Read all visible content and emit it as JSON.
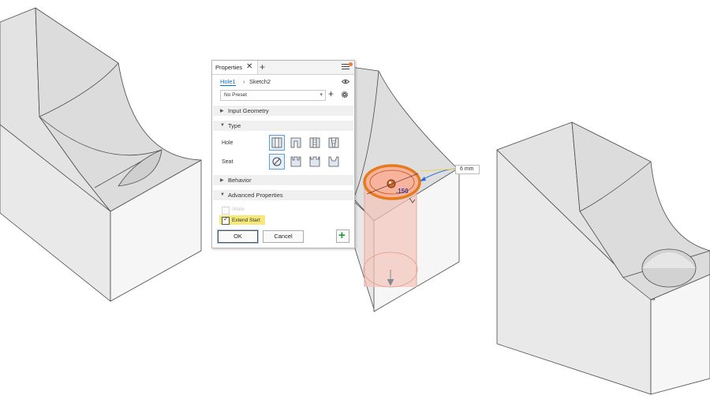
{
  "panel": {
    "tab_label": "Properties",
    "tab_close": "✕",
    "tab_add": "+",
    "breadcrumb": {
      "feature": "Hole1",
      "separator": "›",
      "sketch": "Sketch2"
    },
    "preset": {
      "value": "No Preset",
      "arrow": "▾"
    },
    "preset_add": "+",
    "sections": {
      "input_geometry": "Input Geometry",
      "type": "Type",
      "behavior": "Behavior",
      "advanced": "Advanced Properties"
    },
    "arrows": {
      "collapsed": "▶",
      "expanded": "▼"
    },
    "type_rows": {
      "hole": "Hole",
      "seat": "Seat"
    },
    "disabled_option": "iMate",
    "extend_start": {
      "label": "Extend Start",
      "checked": true,
      "check": "✓"
    },
    "buttons": {
      "ok": "OK",
      "cancel": "Cancel",
      "apply": "+"
    }
  },
  "canvas": {
    "dimension_diameter": "6 mm",
    "dimension_depth": ".150"
  },
  "colors": {
    "accent": "#0a6fd1",
    "highlight": "#f6e97a",
    "apply_green": "#1e9c3c",
    "preview_fill": "#f3b7a8",
    "model_face": "#e9e9e9"
  }
}
